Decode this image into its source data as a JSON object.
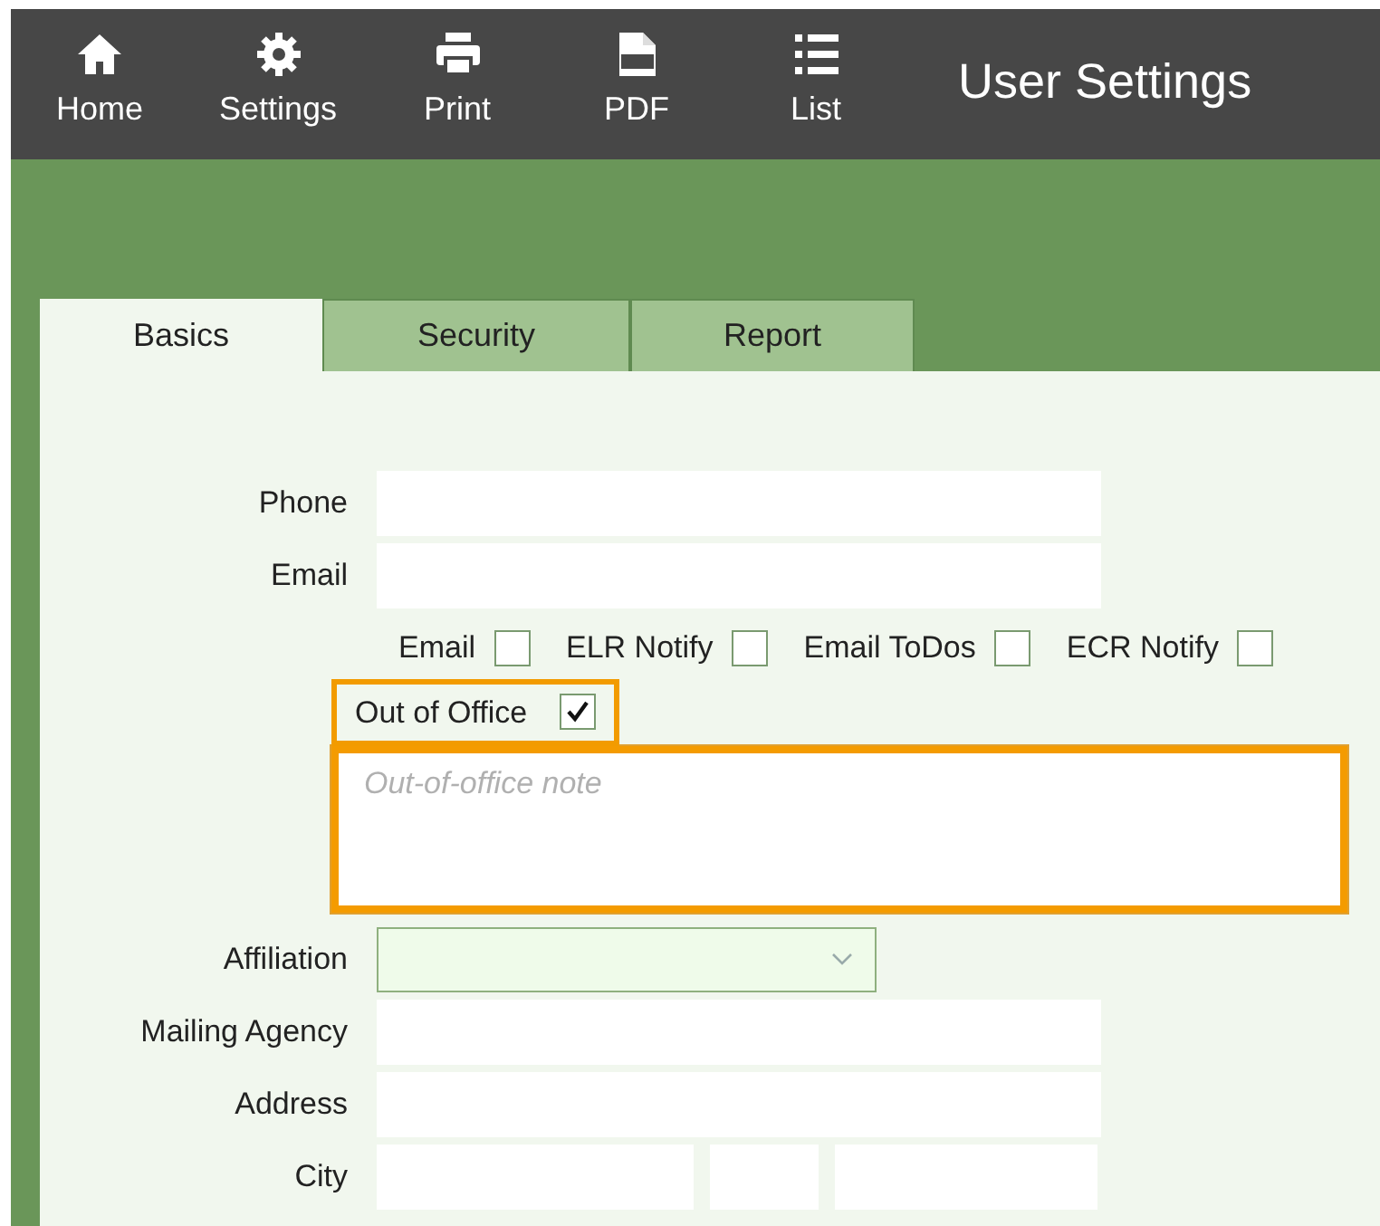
{
  "toolbar": {
    "items": [
      {
        "label": "Home"
      },
      {
        "label": "Settings"
      },
      {
        "label": "Print"
      },
      {
        "label": "PDF"
      },
      {
        "label": "List"
      }
    ],
    "title": "User Settings"
  },
  "tabs": [
    {
      "label": "Basics",
      "selected": true
    },
    {
      "label": "Security",
      "selected": false
    },
    {
      "label": "Report",
      "selected": false
    }
  ],
  "contact_fields": [
    {
      "label": "Phone"
    },
    {
      "label": "Email"
    }
  ],
  "notify_checkboxes": [
    {
      "label": "Email",
      "checked": false
    },
    {
      "label": "ELR Notify",
      "checked": false
    },
    {
      "label": "Email ToDos",
      "checked": false
    },
    {
      "label": "ECR Notify",
      "checked": false
    }
  ],
  "out_of_office": {
    "label": "Out of Office",
    "checked": true,
    "highlighted": true
  },
  "note": {
    "placeholder": "Out-of-office note",
    "highlighted": true
  },
  "address_fields": [
    {
      "label": "Affiliation",
      "kind": "select"
    },
    {
      "label": "Mailing Agency",
      "kind": "text"
    },
    {
      "label": "Address",
      "kind": "text"
    },
    {
      "label": "City",
      "kind": "split"
    }
  ]
}
